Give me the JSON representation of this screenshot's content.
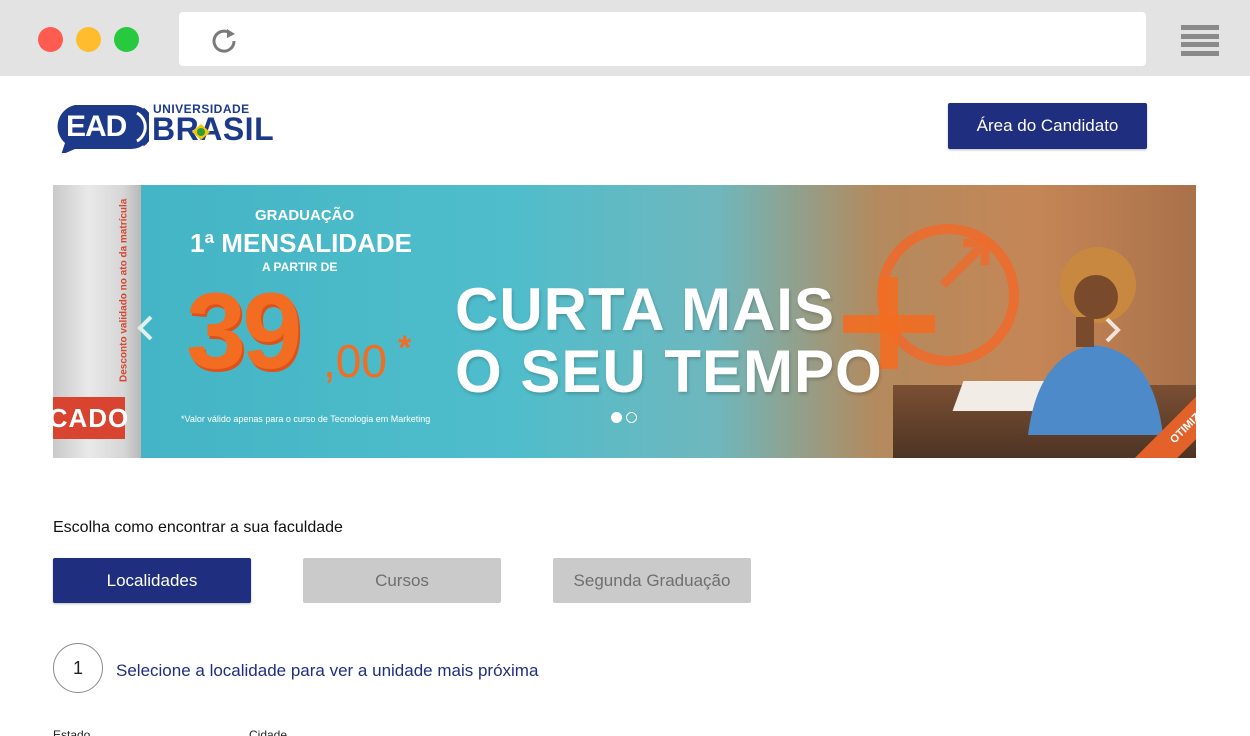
{
  "header": {
    "logo_ead": "EAD",
    "logo_universidade": "UNIVERSIDADE",
    "logo_brasil": "BRASIL",
    "candidate_button": "Área do Candidato"
  },
  "banner": {
    "side_vertical_text": "Desconto validado no ato da matrícula",
    "side_tag": "CADO",
    "graduacao": "GRADUAÇÃO",
    "mensalidade": "1ª MENSALIDADE",
    "a_partir_de": "A PARTIR DE",
    "price_whole": "39",
    "price_cents": ",00",
    "price_star": "*",
    "note": "*Valor válido apenas para o curso de Tecnologia em Marketing",
    "headline_line1": "CURTA MAIS",
    "headline_line2": "O SEU TEMPO",
    "corner_tag": "OTIMIZE",
    "slides_total": 2,
    "slide_active": 1
  },
  "finder": {
    "title": "Escolha como encontrar a sua faculdade",
    "tabs": [
      {
        "label": "Localidades",
        "active": true
      },
      {
        "label": "Cursos",
        "active": false
      },
      {
        "label": "Segunda Graduação",
        "active": false
      }
    ],
    "step_number": "1",
    "step_text": "Selecione a localidade para ver a unidade mais próxima",
    "field_estado": "Estado",
    "field_cidade": "Cidade"
  },
  "colors": {
    "brand_blue": "#1f2e7f",
    "orange": "#f26d21",
    "tab_inactive": "#cacaca"
  }
}
